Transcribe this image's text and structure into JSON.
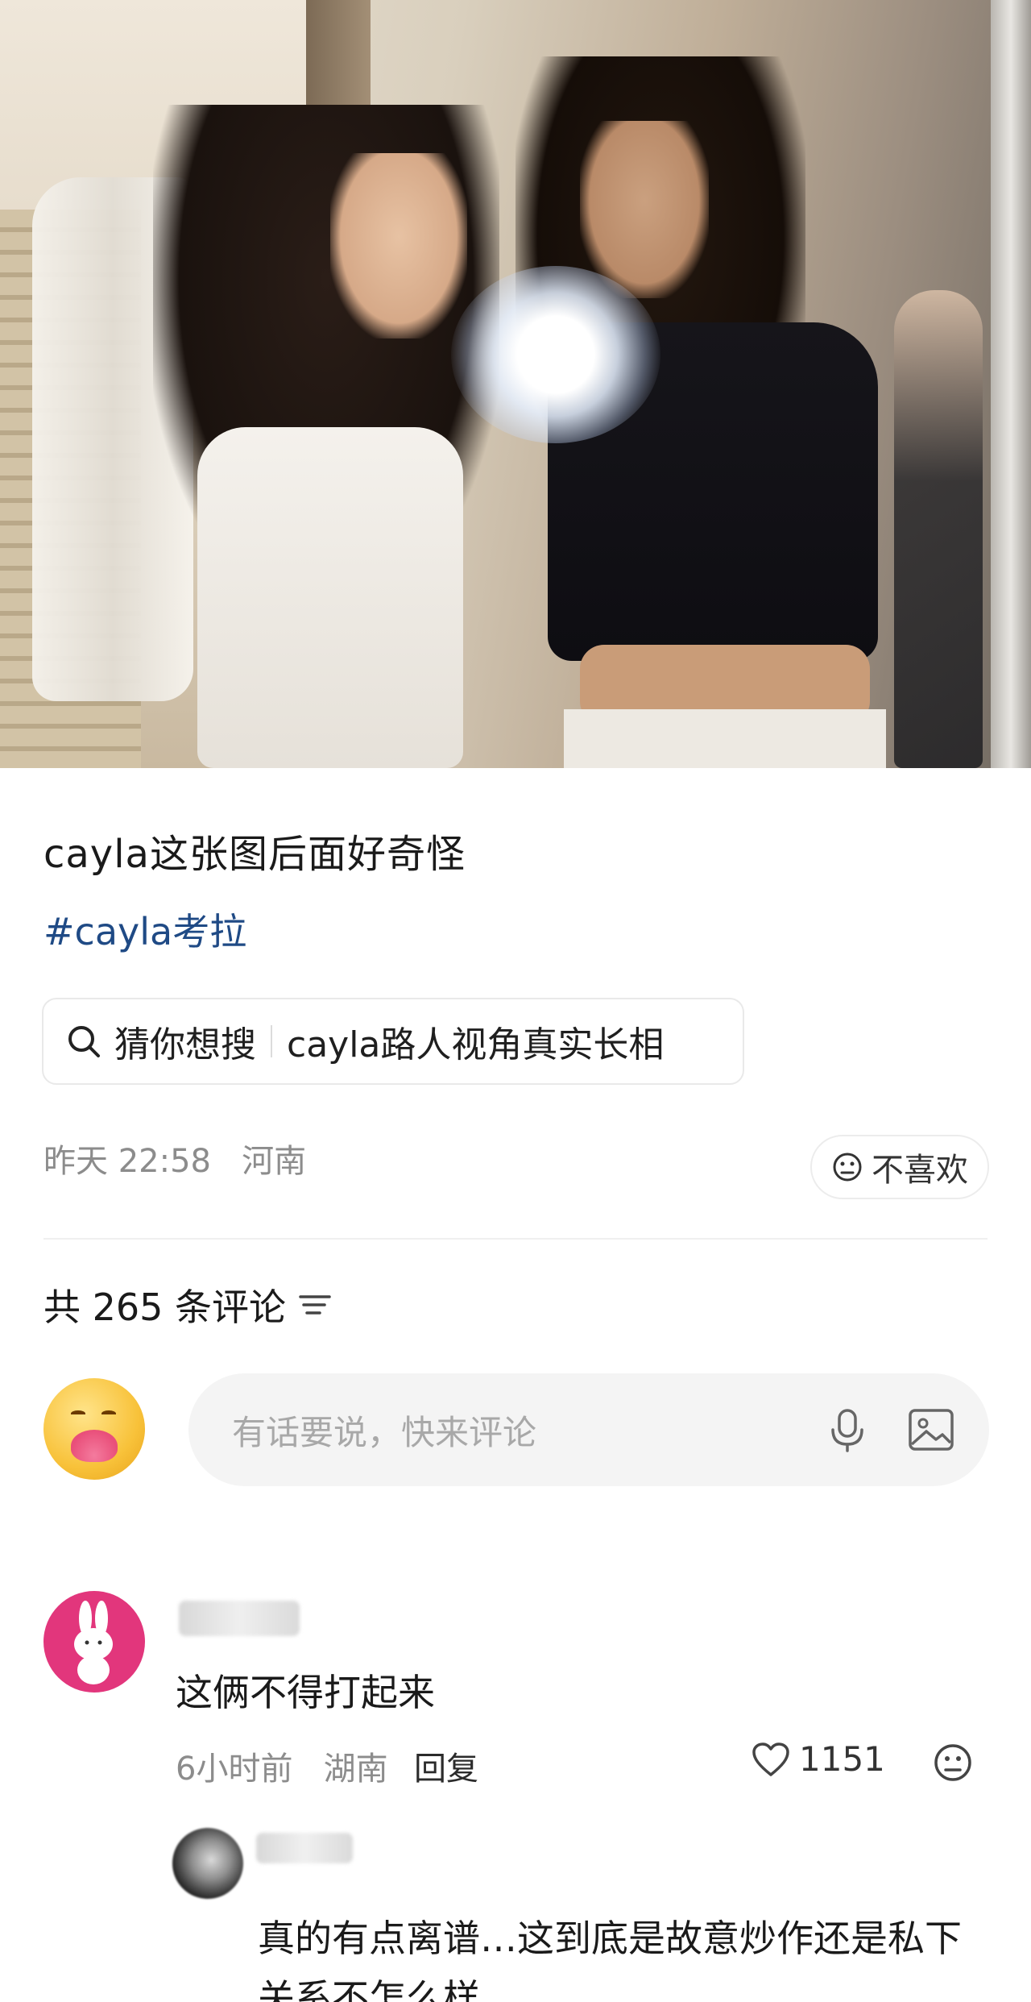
{
  "post": {
    "title": "cayla这张图后面好奇怪",
    "hashtag": "#cayla考拉",
    "search_label": "猜你想搜",
    "search_query": "cayla路人视角真实长相",
    "time": "昨天 22:58",
    "location": "河南",
    "dislike_label": "不喜欢"
  },
  "comments_header": {
    "label": "共 265 条评论"
  },
  "composer": {
    "placeholder": "有话要说，快来评论"
  },
  "comments": [
    {
      "text": "这俩不得打起来",
      "time": "6小时前",
      "location": "湖南",
      "reply_label": "回复",
      "likes": "1151",
      "replies": [
        {
          "text": "真的有点离谱…这到底是故意炒作还是私下关系不怎么样"
        }
      ]
    }
  ],
  "icons": {
    "search": "search-icon",
    "dislike": "sad-face-icon",
    "sort": "sort-icon",
    "mic": "microphone-icon",
    "image": "image-icon",
    "like": "heart-icon",
    "more": "sad-face-icon"
  },
  "colors": {
    "hashtag": "#1f4a85",
    "avatar_pink": "#e2367c",
    "muted": "#8c8c8c"
  }
}
